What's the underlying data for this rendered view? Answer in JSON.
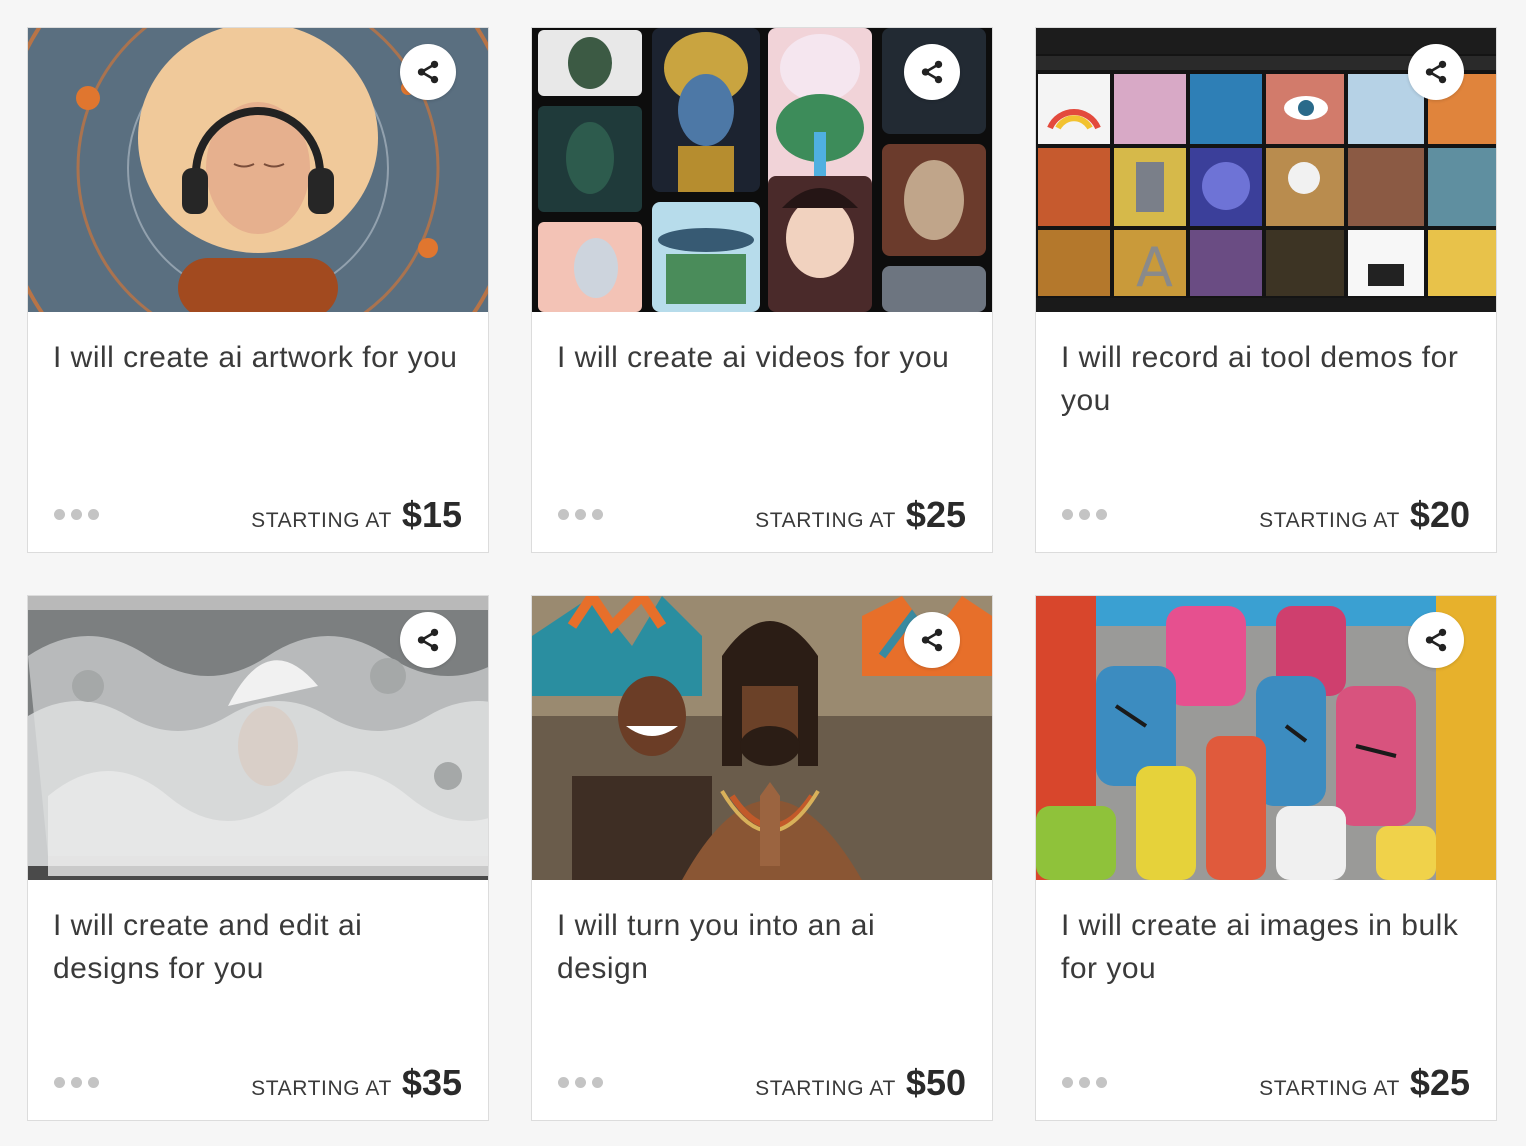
{
  "cards": [
    {
      "title": "I will create ai artwork for you",
      "starting_label": "STARTING AT",
      "price": "$15",
      "image": "ai-artwork-thumbnail",
      "share_icon": "share-icon"
    },
    {
      "title": "I will create ai videos for you",
      "starting_label": "STARTING AT",
      "price": "$25",
      "image": "ai-videos-thumbnail",
      "share_icon": "share-icon"
    },
    {
      "title": "I will record ai tool demos for you",
      "starting_label": "STARTING AT",
      "price": "$20",
      "image": "ai-tool-demos-thumbnail",
      "share_icon": "share-icon"
    },
    {
      "title": "I will create and edit ai designs for you",
      "starting_label": "STARTING AT",
      "price": "$35",
      "image": "ai-designs-thumbnail",
      "share_icon": "share-icon"
    },
    {
      "title": "I will turn you into an ai design",
      "starting_label": "STARTING AT",
      "price": "$50",
      "image": "ai-portrait-thumbnail",
      "share_icon": "share-icon"
    },
    {
      "title": "I will create ai images in bulk for you",
      "starting_label": "STARTING AT",
      "price": "$25",
      "image": "ai-bulk-images-thumbnail",
      "share_icon": "share-icon"
    }
  ],
  "colors": {
    "card_bg": "#ffffff",
    "page_bg": "#f6f6f6",
    "dots": "#c4c4c4",
    "text": "#3a3a3a"
  }
}
